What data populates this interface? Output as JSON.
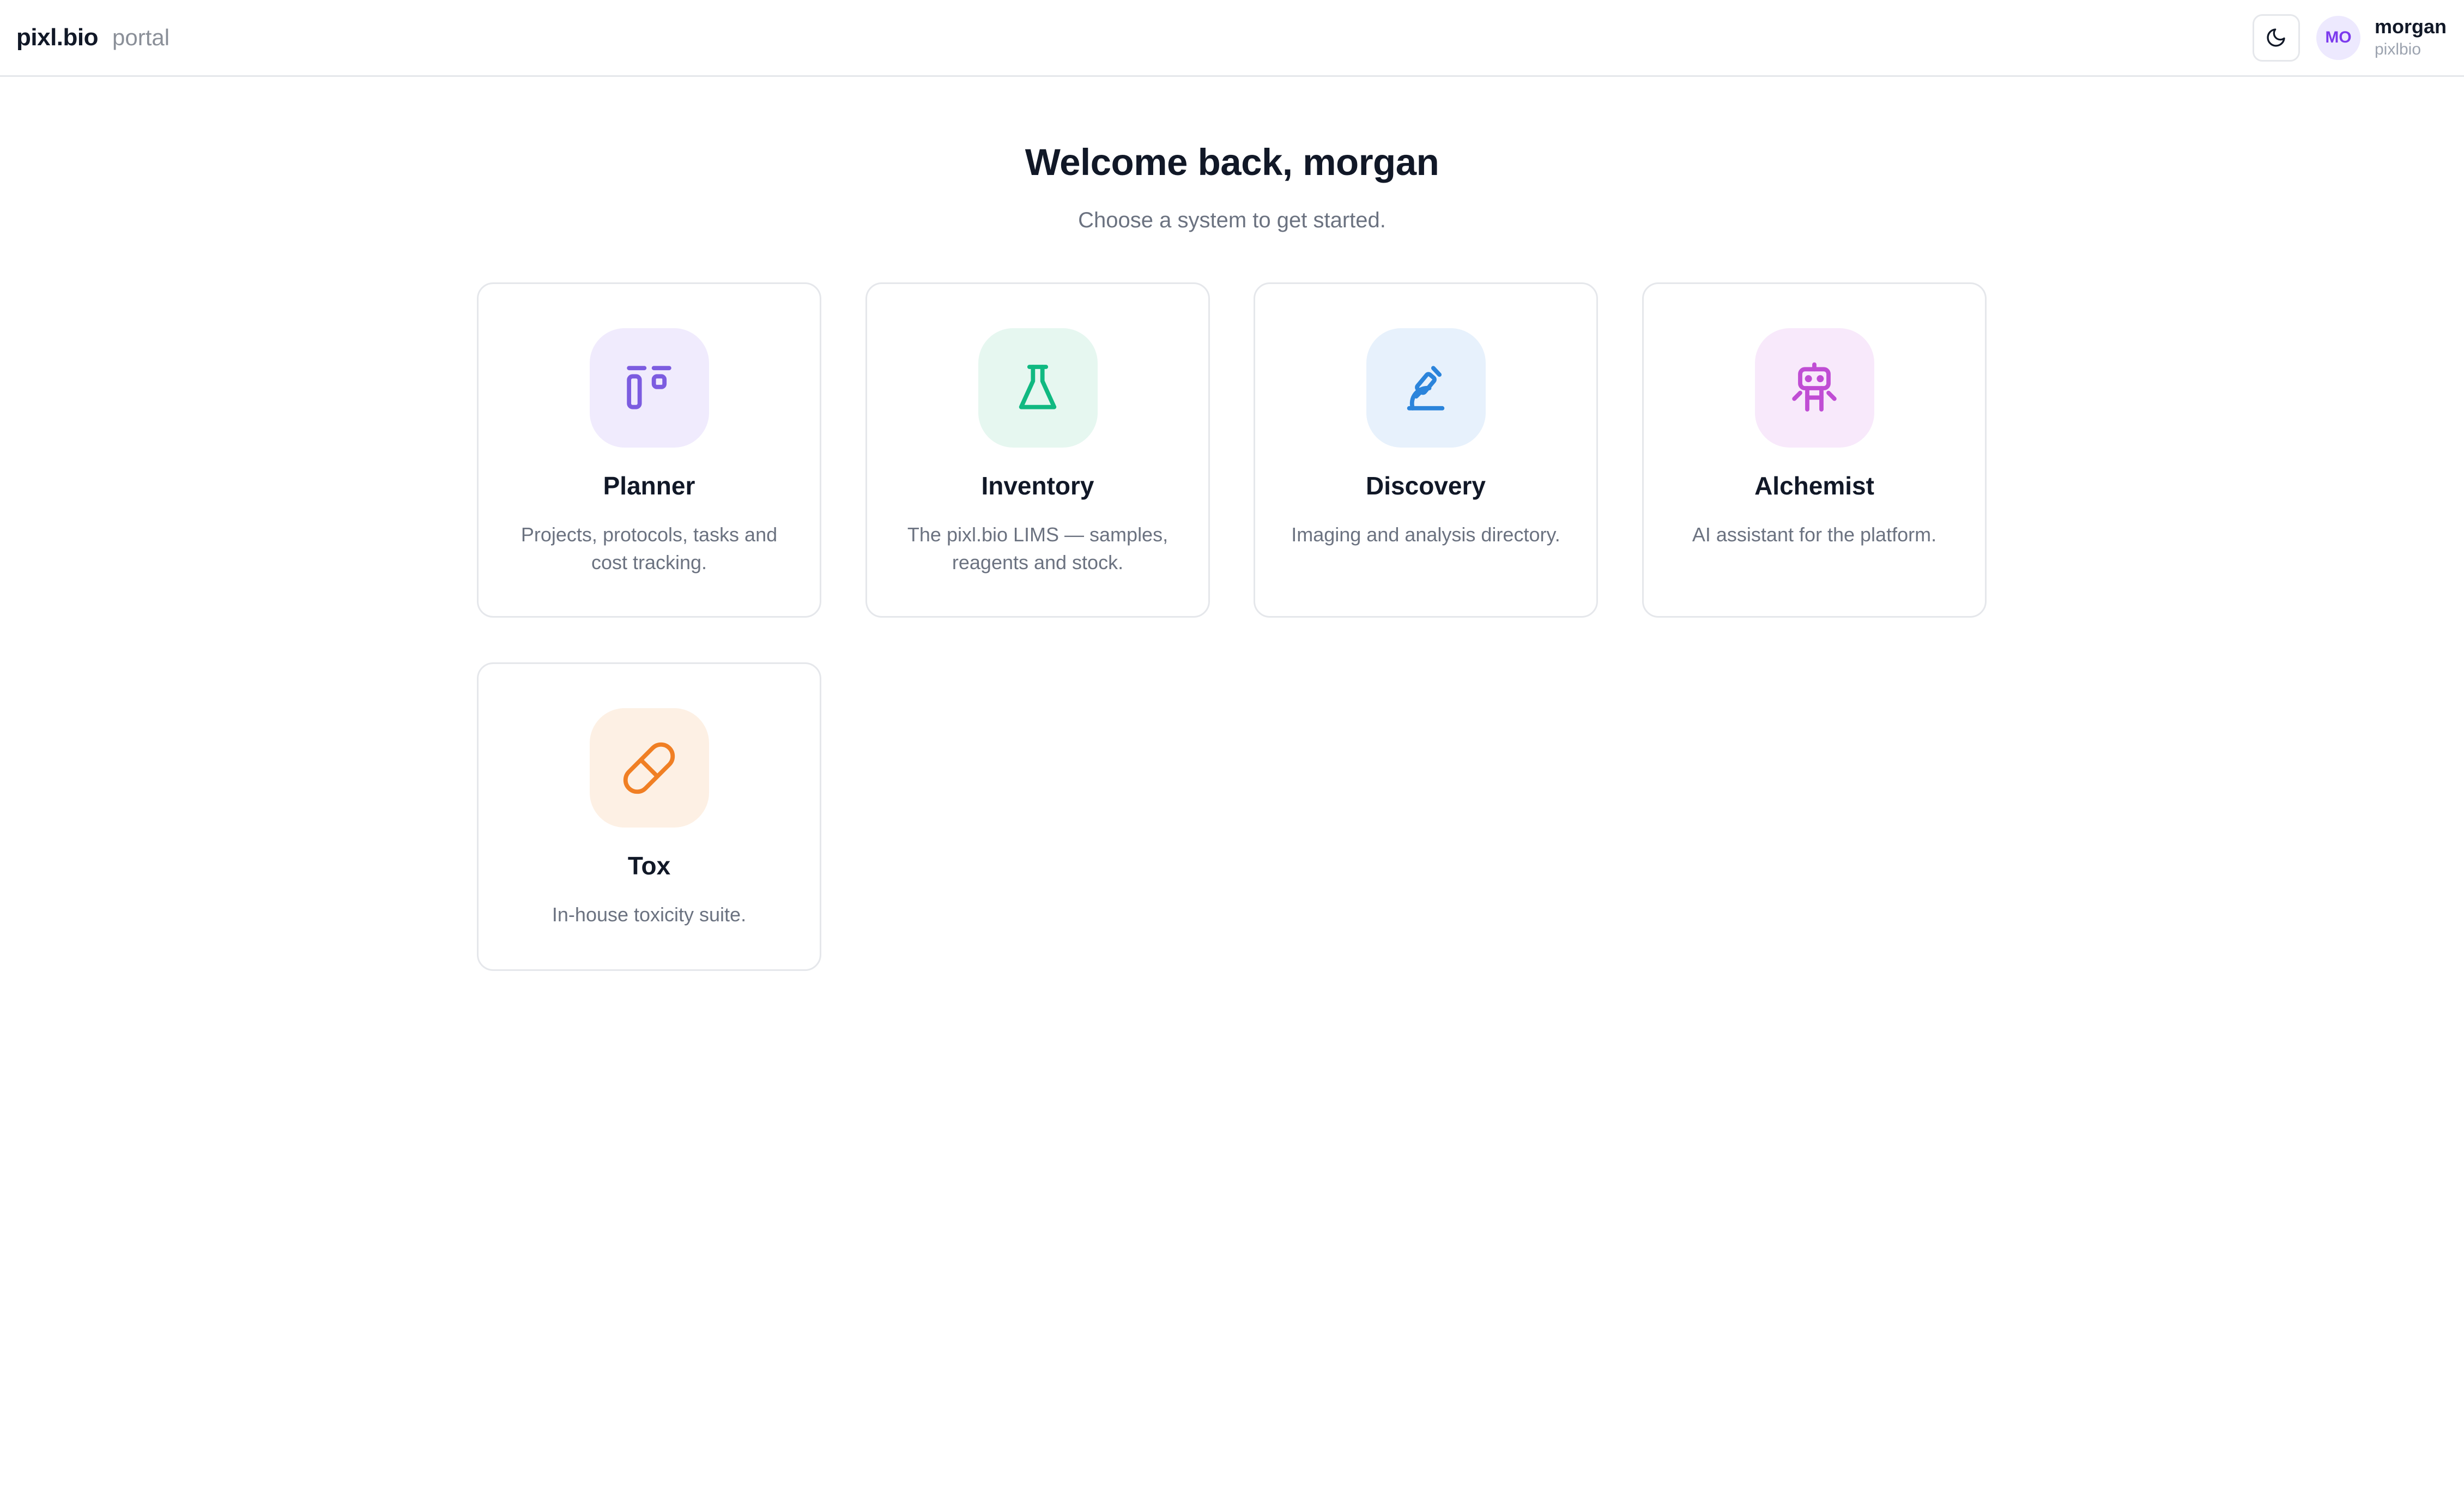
{
  "header": {
    "brand": "pixl.bio",
    "brand_sub": "portal",
    "theme_toggle_icon": "moon-icon",
    "user": {
      "initials": "MO",
      "name": "morgan",
      "org": "pixlbio"
    }
  },
  "welcome": {
    "title": "Welcome back, morgan",
    "subtitle": "Choose a system to get started."
  },
  "systems": [
    {
      "name": "Planner",
      "description": "Projects, protocols, tasks and cost tracking.",
      "icon": "layout-icon",
      "accent": "#7c5ce0",
      "tile": "#f0ebfd"
    },
    {
      "name": "Inventory",
      "description": "The pixl.bio LIMS — samples, reagents and stock.",
      "icon": "flask-icon",
      "accent": "#10b981",
      "tile": "#e6f7f0"
    },
    {
      "name": "Discovery",
      "description": "Imaging and analysis directory.",
      "icon": "microscope-icon",
      "accent": "#2b84db",
      "tile": "#e7f1fc"
    },
    {
      "name": "Alchemist",
      "description": "AI assistant for the platform.",
      "icon": "robot-icon",
      "accent": "#c04dd4",
      "tile": "#f8e9fb"
    },
    {
      "name": "Tox",
      "description": "In-house toxicity suite.",
      "icon": "pill-icon",
      "accent": "#f07f24",
      "tile": "#fdf0e4"
    }
  ]
}
